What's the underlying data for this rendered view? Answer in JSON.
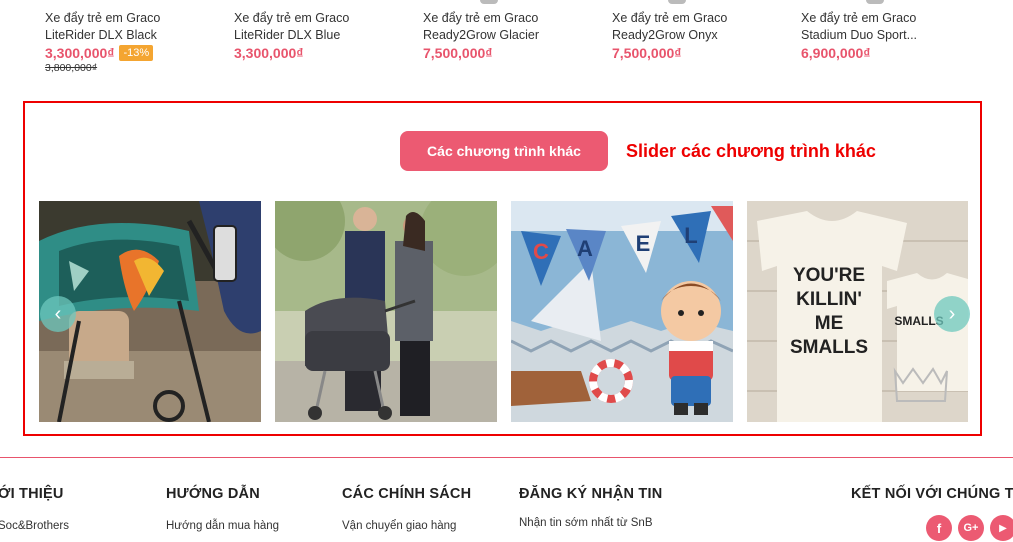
{
  "products": [
    {
      "name_line1": "Xe đẩy trẻ em Graco",
      "name_line2": "LiteRider DLX Black",
      "price": "3,300,000₫",
      "discount": "-13%",
      "old_price": "3,800,000₫"
    },
    {
      "name_line1": "Xe đẩy trẻ em Graco",
      "name_line2": "LiteRider DLX Blue",
      "price": "3,300,000₫"
    },
    {
      "name_line1": "Xe đẩy trẻ em Graco",
      "name_line2": "Ready2Grow Glacier",
      "price": "7,500,000₫"
    },
    {
      "name_line1": "Xe đẩy trẻ em Graco",
      "name_line2": "Ready2Grow Onyx",
      "price": "7,500,000₫"
    },
    {
      "name_line1": "Xe đẩy trẻ em Graco",
      "name_line2": "Stadium Duo Sport...",
      "price": "6,900,000₫"
    }
  ],
  "slider": {
    "title_button": "Các chương trình khác",
    "annotation": "Slider các chương trình khác",
    "prev_icon": "‹",
    "next_icon": "›",
    "slides": [
      {
        "icon": "stroller-parrot-canopy-photo"
      },
      {
        "icon": "couple-with-pram-photo"
      },
      {
        "icon": "sailor-doll-bunting-photo",
        "bunting_letters": [
          "C",
          "A",
          "E",
          "L"
        ]
      },
      {
        "icon": "killin-me-smalls-tshirts-photo",
        "shirt_text_lines": [
          "YOU'RE",
          "KILLIN'",
          "ME",
          "SMALLS"
        ],
        "small_shirt_text": "SMALLS"
      }
    ]
  },
  "footer": {
    "about_title": "ỚI THIỆU",
    "about_link": "Soc&Brothers",
    "guide_title": "HƯỚNG DẪN",
    "guide_link": "Hướng dẫn mua hàng",
    "policy_title": "CÁC CHÍNH SÁCH",
    "policy_link": "Vận chuyển giao hàng",
    "newsletter_title": "ĐĂNG KÝ NHẬN TIN",
    "newsletter_text": "Nhận tin sớm nhất từ SnB",
    "connect_title": "KẾT NỐI VỚI CHÚNG TÔ",
    "social": [
      {
        "icon": "facebook-icon",
        "glyph": "f"
      },
      {
        "icon": "google-plus-icon",
        "glyph": "G+"
      },
      {
        "icon": "youtube-icon",
        "glyph": "▶"
      }
    ]
  },
  "colors": {
    "accent": "#ec5a72",
    "price": "#e8546c",
    "annotation": "#ee0000",
    "discount": "#f4a531"
  }
}
